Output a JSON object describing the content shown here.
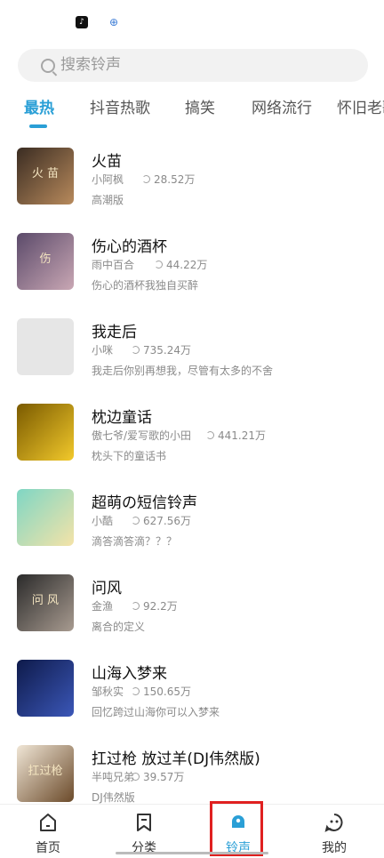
{
  "search": {
    "placeholder": "搜索铃声"
  },
  "tabs": [
    {
      "label": "最热"
    },
    {
      "label": "抖音热歌"
    },
    {
      "label": "搞笑"
    },
    {
      "label": "网络流行"
    },
    {
      "label": "怀旧老歌"
    }
  ],
  "songs": [
    {
      "title": "火苗",
      "artist": "小阿枫",
      "plays": "28.52万",
      "desc": "高潮版",
      "cover_text": "火 苗",
      "cover_colors": [
        "#3a2c22",
        "#b88a5c"
      ]
    },
    {
      "title": "伤心的酒杯",
      "artist": "雨中百合",
      "plays": "44.22万",
      "desc": "伤心的酒杯我独自买醉",
      "cover_text": "伤",
      "cover_colors": [
        "#5b4a6a",
        "#c9a7b4"
      ]
    },
    {
      "title": "我走后",
      "artist": "小咪",
      "plays": "735.24万",
      "desc": "我走后你别再想我，尽管有太多的不舍",
      "cover_text": "",
      "cover_colors": [
        "#e6e6e6",
        "#e6e6e6"
      ]
    },
    {
      "title": "枕边童话",
      "artist": "傲七爷/爱写歌的小田",
      "plays": "441.21万",
      "desc": "枕头下的童话书",
      "cover_text": "",
      "cover_colors": [
        "#7a5a00",
        "#f2c92b"
      ]
    },
    {
      "title": "超萌の短信铃声",
      "artist": "小酷",
      "plays": "627.56万",
      "desc": "滴答滴答滴？？？",
      "cover_text": "",
      "cover_colors": [
        "#7fd6c4",
        "#f4e3a8"
      ]
    },
    {
      "title": "问风",
      "artist": "金渔",
      "plays": "92.2万",
      "desc": "离合的定义",
      "cover_text": "问 风",
      "cover_colors": [
        "#2a2a2a",
        "#a89b90"
      ]
    },
    {
      "title": "山海入梦来",
      "artist": "邹秋实",
      "plays": "150.65万",
      "desc": "回忆跨过山海你可以入梦来",
      "cover_text": "",
      "cover_colors": [
        "#0e1a4a",
        "#3b57b8"
      ]
    },
    {
      "title": "扛过枪 放过羊(DJ伟然版)",
      "artist": "半吨兄弟",
      "plays": "39.57万",
      "desc": "DJ伟然版",
      "cover_text": "扛过枪",
      "cover_colors": [
        "#f0e6d6",
        "#6b4a2a"
      ]
    }
  ],
  "bottom_nav": [
    {
      "label": "首页",
      "icon": "home-icon"
    },
    {
      "label": "分类",
      "icon": "category-icon"
    },
    {
      "label": "铃声",
      "icon": "bell-icon",
      "active": true
    },
    {
      "label": "我的",
      "icon": "profile-icon"
    }
  ],
  "colors": {
    "accent": "#2a9fd6",
    "highlight": "#e02020"
  }
}
